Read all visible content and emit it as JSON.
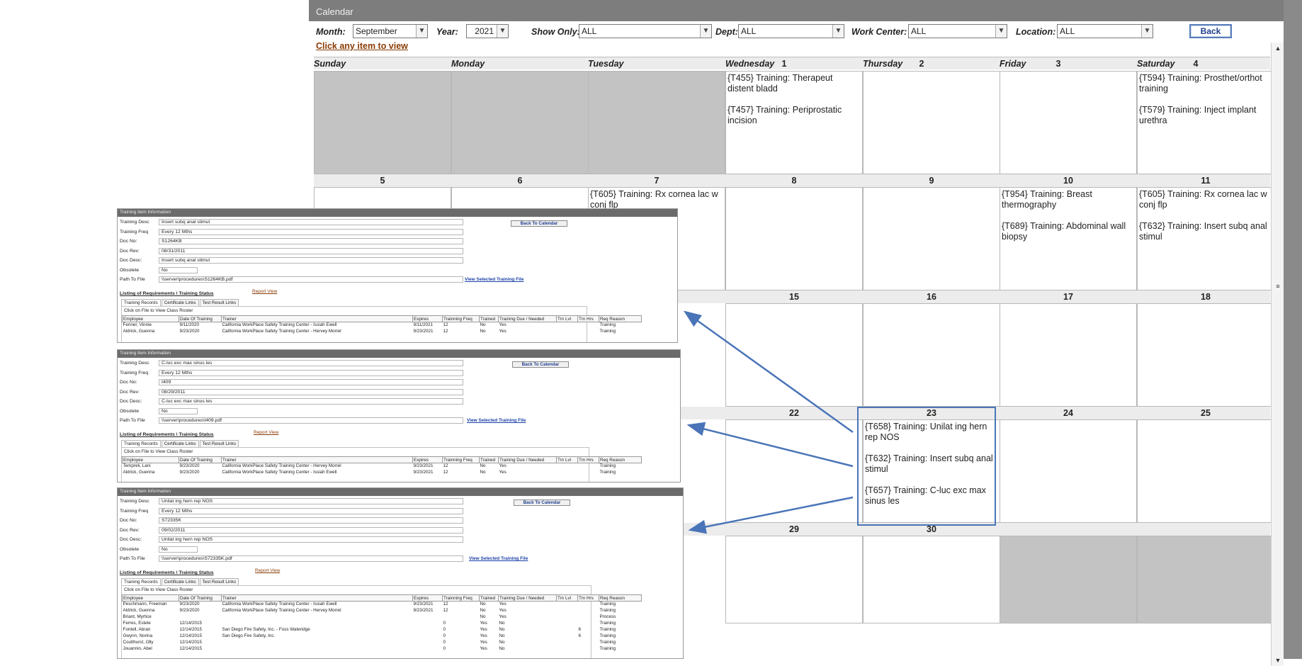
{
  "calendar": {
    "title": "Calendar",
    "filters": {
      "month_label": "Month:",
      "month_value": "September",
      "year_label": "Year:",
      "year_value": "2021",
      "show_only_label": "Show Only:",
      "show_only_value": "ALL",
      "dept_label": "Dept:",
      "dept_value": "ALL",
      "work_center_label": "Work Center:",
      "work_center_value": "ALL",
      "location_label": "Location:",
      "location_value": "ALL"
    },
    "back_label": "Back",
    "click_hint": "Click any item to view",
    "weekdays": [
      "Sunday",
      "Monday",
      "Tuesday",
      "Wednesday",
      "Thursday",
      "Friday",
      "Saturday"
    ],
    "week1_numbers": [
      "",
      "",
      "",
      "1",
      "2",
      "3",
      "4"
    ],
    "weeks": [
      {
        "numbers": [
          "5",
          "6",
          "7",
          "8",
          "9",
          "10",
          "11"
        ]
      },
      {
        "numbers": [
          "",
          "",
          "",
          "15",
          "16",
          "17",
          "18"
        ]
      },
      {
        "numbers": [
          "",
          "",
          "",
          "22",
          "23",
          "24",
          "25"
        ]
      },
      {
        "numbers": [
          "",
          "",
          "",
          "29",
          "30",
          "",
          ""
        ]
      }
    ],
    "events": {
      "d1": [
        "{T455} Training: Therapeut distent bladd",
        "{T457} Training: Periprostatic incision"
      ],
      "d4": [
        "{T594} Training: Prosthet/orthot training",
        "{T579} Training: Inject implant urethra"
      ],
      "d7": [
        "{T605} Training: Rx cornea lac w conj flp"
      ],
      "d10": [
        "{T954} Training: Breast thermography",
        "{T689} Training: Abdominal wall biopsy"
      ],
      "d11": [
        "{T605} Training: Rx cornea lac w conj flp",
        "{T632} Training: Insert subq anal stimul"
      ],
      "d23": [
        "{T658} Training: Unilat ing hern rep NOS",
        "{T632} Training: Insert subq anal stimul",
        "{T657} Training: C-luc exc max sinus les"
      ]
    }
  },
  "training_windows": [
    {
      "title": "Training Item Information",
      "fields": [
        {
          "label": "Training Desc",
          "value": "Insert subq anal stimul"
        },
        {
          "label": "Training Freq",
          "value": "Every 12 Mths"
        },
        {
          "label": "Doc No:",
          "value": "S1264KB"
        },
        {
          "label": "Doc Rev:",
          "value": "08/31/2011"
        },
        {
          "label": "Doc Desc:",
          "value": "Insert subq anal stimul"
        },
        {
          "label": "Obsolete",
          "value": "No"
        },
        {
          "label": "Path To File",
          "value": "\\\\server\\procedures\\S1264KB.pdf"
        }
      ],
      "back_to_calendar": "Back To Calendar",
      "view_file": "View Selected Training File",
      "report_view": "Report View",
      "section": "Listing of Requirements \\ Training Status",
      "tabs": [
        "Training Records",
        "Certificate Links",
        "Test Result Links"
      ],
      "roster_hint": "Click on File to View Class Roster",
      "columns": [
        "Employee",
        "Date Of Training",
        "Trainer",
        "Expires",
        "Trainning Freq",
        "Trained",
        "Training Due / Needed",
        "Trn Lvl",
        "Trn Hrs",
        "Req Reason"
      ],
      "rows": [
        [
          "Fenner, Vinnie",
          "9/11/2020",
          "California WorkPlace Safety Training Center - Issiah Ewell",
          "9/11/2021",
          "12",
          "No",
          "Yes",
          "",
          "",
          "Training"
        ],
        [
          "Aldrick, Guenna",
          "9/23/2020",
          "California WorkPlace Safety Training Center - Hervey Morrel",
          "9/23/2021",
          "12",
          "No",
          "Yes",
          "",
          "",
          "Training"
        ]
      ]
    },
    {
      "title": "Training Item Information",
      "fields": [
        {
          "label": "Training Desc",
          "value": "C-luc exc max sinus les"
        },
        {
          "label": "Training Freq",
          "value": "Every 12 Mths"
        },
        {
          "label": "Doc No:",
          "value": "I409"
        },
        {
          "label": "Doc Rev:",
          "value": "08/29/2011"
        },
        {
          "label": "Doc Desc:",
          "value": "C-luc exc max sinus les"
        },
        {
          "label": "Obsolete",
          "value": "No"
        },
        {
          "label": "Path To File",
          "value": "\\\\server\\procedures\\I409.pdf"
        }
      ],
      "back_to_calendar": "Back To Calendar",
      "view_file": "View Selected Training File",
      "report_view": "Report View",
      "section": "Listing of Requirements \\ Training Status",
      "tabs": [
        "Training Records",
        "Certificate Links",
        "Test Result Links"
      ],
      "roster_hint": "Click on File to View Class Roster",
      "columns": [
        "Employee",
        "Date Of Training",
        "Trainer",
        "Expires",
        "Trainning Freq",
        "Trained",
        "Training Due / Needed",
        "Trn Lvl",
        "Trn Hrs",
        "Req Reason"
      ],
      "rows": [
        [
          "Tempreli, Lani",
          "9/23/2020",
          "California WorkPlace Safety Training Center - Hervey Morrel",
          "9/23/2021",
          "12",
          "No",
          "Yes",
          "",
          "",
          "Training"
        ],
        [
          "Aldrick, Guenna",
          "9/23/2020",
          "California WorkPlace Safety Training Center - Issiah Ewell",
          "9/23/2021",
          "12",
          "No",
          "Yes",
          "",
          "",
          "Training"
        ]
      ]
    },
    {
      "title": "Training Item Information",
      "fields": [
        {
          "label": "Training Desc",
          "value": "Unilat ing hern rep NOS"
        },
        {
          "label": "Training Freq",
          "value": "Every 12 Mths"
        },
        {
          "label": "Doc No:",
          "value": "S72335K"
        },
        {
          "label": "Doc Rev:",
          "value": "09/02/2011"
        },
        {
          "label": "Doc Desc:",
          "value": "Unilat ing hern rep NOS"
        },
        {
          "label": "Obsolete",
          "value": "No"
        },
        {
          "label": "Path To File",
          "value": "\\\\server\\procedures\\S72335K.pdf"
        }
      ],
      "back_to_calendar": "Back To Calendar",
      "view_file": "View Selected Training File",
      "report_view": "Report View",
      "section": "Listing of Requirements \\ Training Status",
      "tabs": [
        "Training Records",
        "Certificate Links",
        "Test Result Links"
      ],
      "roster_hint": "Click on File to View Class Roster",
      "columns": [
        "Employee",
        "Date Of Training",
        "Trainer",
        "Expires",
        "Trainning Freq",
        "Trained",
        "Training Due / Needed",
        "Trn Lvl",
        "Trn Hrs",
        "Req Reason"
      ],
      "rows": [
        [
          "Peschmann, Freeman",
          "9/23/2020",
          "California WorkPlace Safety Training Center - Issiah Ewell",
          "9/23/2021",
          "12",
          "No",
          "Yes",
          "",
          "",
          "Training"
        ],
        [
          "Aldrick, Guenna",
          "9/23/2020",
          "California WorkPlace Safety Training Center - Hervey Morrel",
          "9/23/2021",
          "12",
          "No",
          "Yes",
          "",
          "",
          "Training"
        ],
        [
          "Briant, Myrtice",
          "",
          "",
          "",
          "",
          "No",
          "Yes",
          "",
          "",
          "Process"
        ],
        [
          "Ferres, Estele",
          "12/14/2015",
          "",
          "",
          "0",
          "Yes",
          "No",
          "",
          "",
          "Training"
        ],
        [
          "Fontell, Abran",
          "12/14/2015",
          "San Diego Fire Safety, Inc. - Foss Wateridge",
          "",
          "0",
          "Yes",
          "No",
          "",
          "6",
          "Training"
        ],
        [
          "Gwynn, Norina",
          "12/14/2015",
          "San Diego Fire Safety, Inc.",
          "",
          "0",
          "Yes",
          "No",
          "",
          "6",
          "Training"
        ],
        [
          "Coulthurst, Olly",
          "12/14/2015",
          "",
          "",
          "0",
          "Yes",
          "No",
          "",
          "",
          "Training"
        ],
        [
          "Jouannin, Abel",
          "12/14/2015",
          "",
          "",
          "0",
          "Yes",
          "No",
          "",
          "",
          "Training"
        ]
      ]
    }
  ],
  "colors": {
    "accent": "#4a74b8",
    "link": "#1a3fa7",
    "hint": "#8a3b05",
    "gray_cell": "#c3c3c3"
  }
}
